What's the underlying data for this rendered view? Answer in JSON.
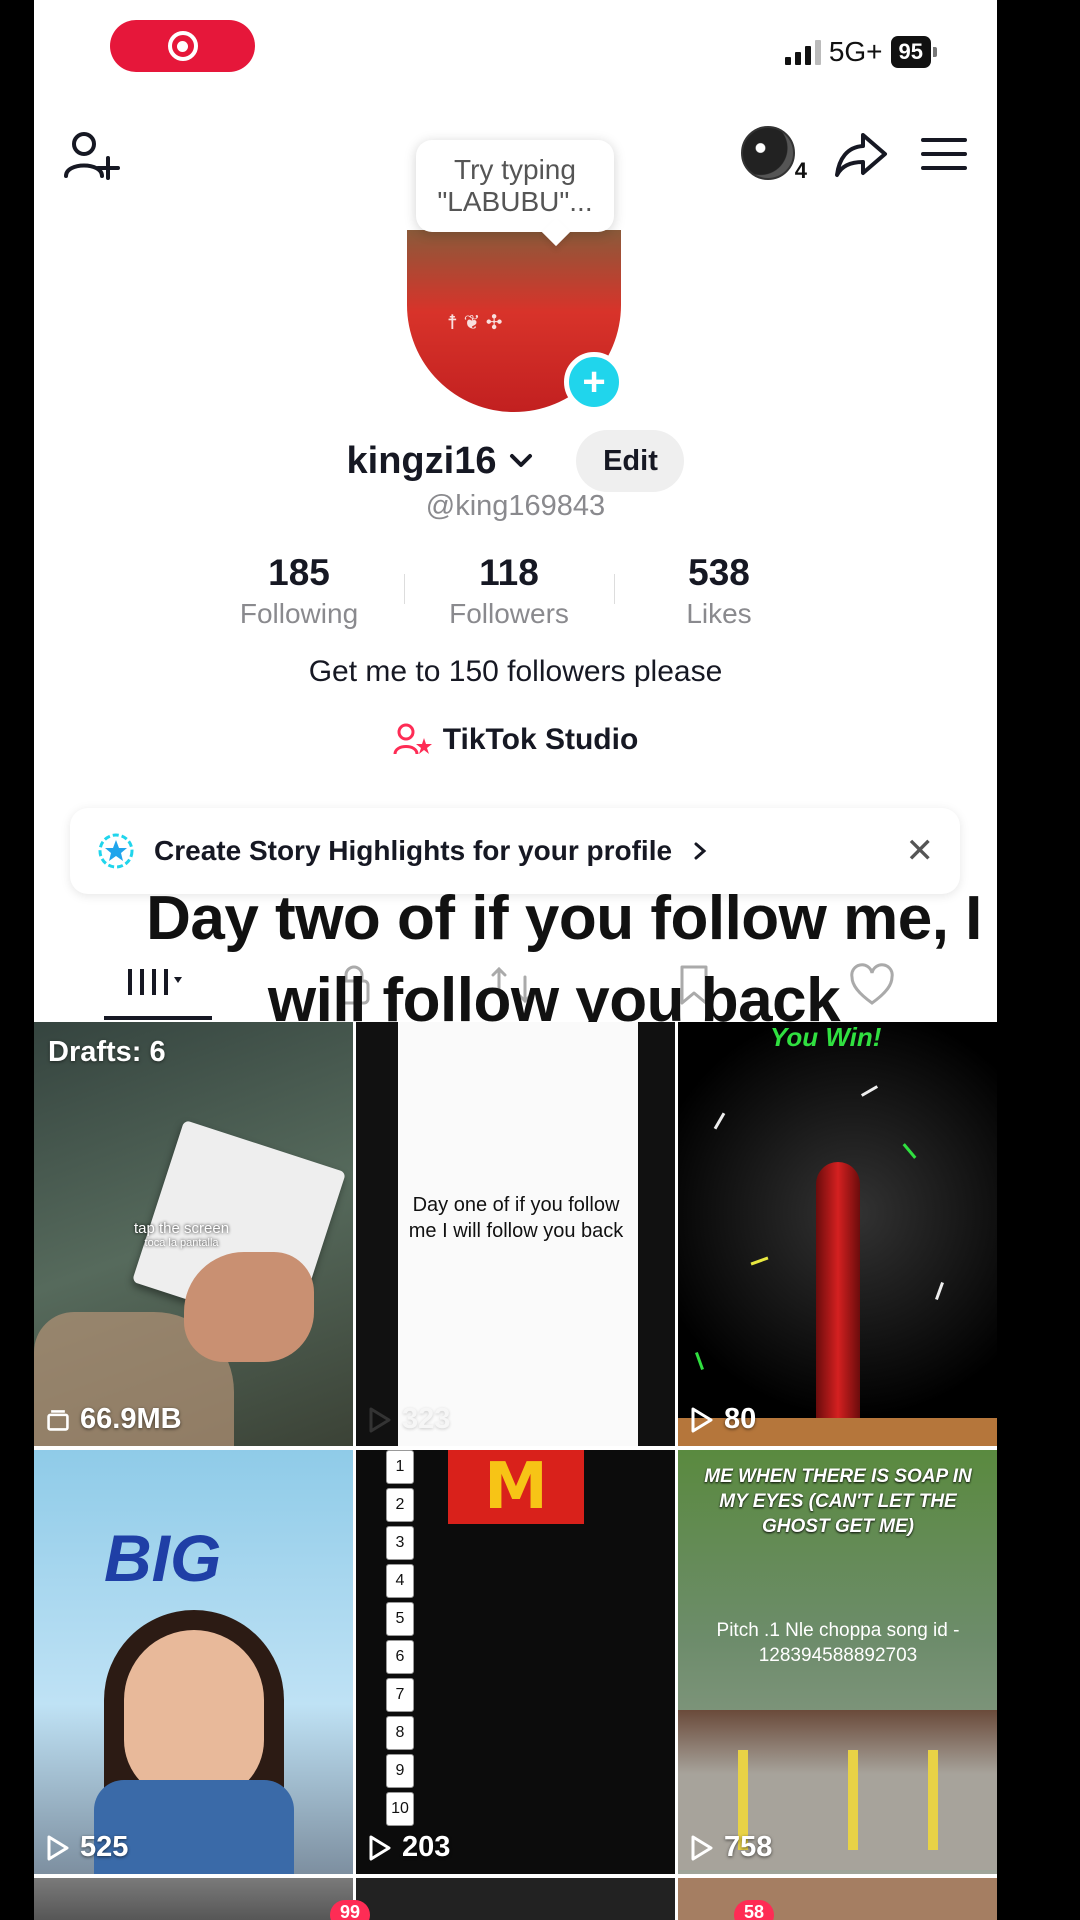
{
  "status_bar": {
    "network": "5G+",
    "battery": "95"
  },
  "header": {
    "tooltip": "Try typing \"LABUBU\"...",
    "avatar_count": "4"
  },
  "profile": {
    "username": "kingzi16",
    "edit_label": "Edit",
    "handle": "@king169843",
    "stats": [
      {
        "value": "185",
        "label": "Following"
      },
      {
        "value": "118",
        "label": "Followers"
      },
      {
        "value": "538",
        "label": "Likes"
      }
    ],
    "bio": "Get me to 150 followers please",
    "studio_label": "TikTok Studio"
  },
  "highlights_banner": {
    "text": "Create Story Highlights for your profile"
  },
  "overlay_caption": {
    "line1": "Day two of if you follow me, I",
    "line2": "will follow you back"
  },
  "grid": {
    "drafts_label": "Drafts: 6",
    "items": [
      {
        "meta": "66.9MB",
        "overlay": "tap the screen",
        "overlay2": "toca la pantalla"
      },
      {
        "meta": "323",
        "overlay": "Day one of if you follow me I will follow you back"
      },
      {
        "meta": "80",
        "overlay": "You Win!"
      },
      {
        "meta": "525",
        "overlay": "BIG"
      },
      {
        "meta": "203"
      },
      {
        "meta": "758",
        "overlay": "ME WHEN THERE IS SOAP IN MY EYES (CAN'T LET THE GHOST GET ME)",
        "overlay2": "Pitch .1 Nle choppa song id - 128394588892703"
      }
    ]
  },
  "bottom_nav": {
    "badge_inbox": "99",
    "badge_profile": "58"
  },
  "colors": {
    "accent_red": "#fe2c55",
    "cyan": "#20d5ec",
    "rec_red": "#e6173a"
  }
}
